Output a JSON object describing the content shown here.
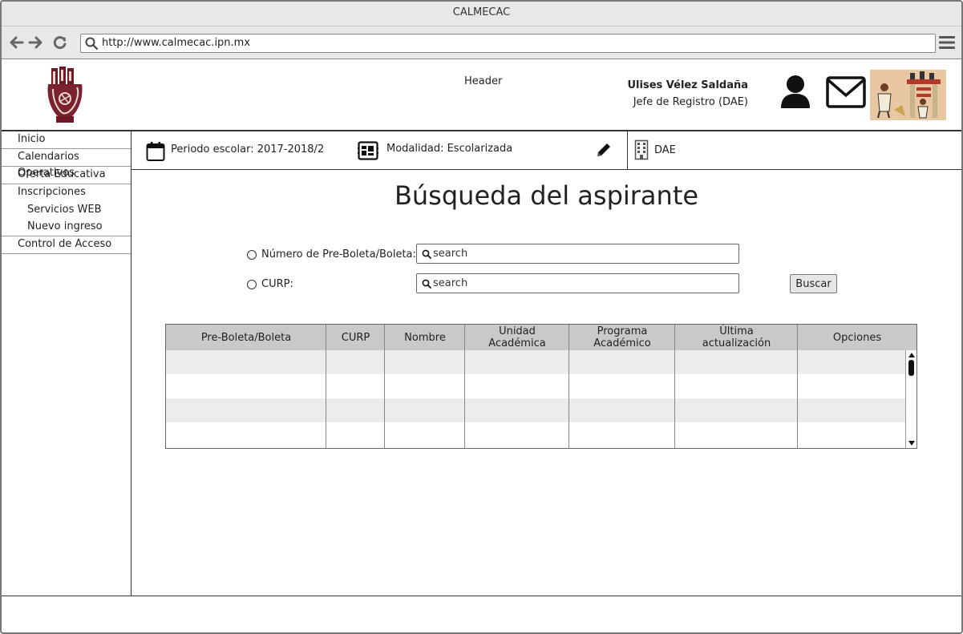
{
  "window": {
    "title": "CALMECAC"
  },
  "browser": {
    "url": "http://www.calmecac.ipn.mx"
  },
  "header": {
    "label": "Header",
    "user_name": "Ulises Vélez Saldaña",
    "user_role": "Jefe de Registro (DAE)"
  },
  "sidebar": {
    "items": [
      {
        "label": "Inicio"
      },
      {
        "label": "Calendarios Operativos"
      },
      {
        "label": "Oferta Educativa"
      },
      {
        "label": "Inscripciones"
      },
      {
        "label": "Servicios WEB"
      },
      {
        "label": "Nuevo ingreso"
      },
      {
        "label": "Control de Acceso"
      }
    ]
  },
  "infobar": {
    "periodo": "Periodo escolar: 2017-2018/2",
    "modalidad": "Modalidad: Escolarizada",
    "unidad": "DAE"
  },
  "main": {
    "title": "Búsqueda del aspirante",
    "option_boleta": "Número de Pre-Boleta/Boleta:",
    "option_curp": "CURP:",
    "search_placeholder": "search",
    "search_button": "Buscar"
  },
  "table": {
    "columns": [
      "Pre-Boleta/Boleta",
      "CURP",
      "Nombre",
      "Unidad\nAcadémica",
      "Programa\nAcadémico",
      "Última\nactualización",
      "Opciones"
    ],
    "rows": []
  },
  "colors": {
    "logo_maroon": "#6d1a24",
    "table_header": "#c9c9c9",
    "row_alt": "#ececec"
  }
}
